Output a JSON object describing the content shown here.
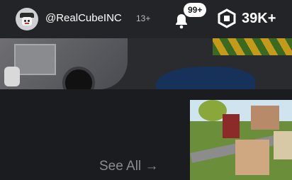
{
  "header": {
    "username": "@RealCubeINC",
    "age_badge": "13+",
    "notifications_count": "99+",
    "robux_amount": "39K+"
  },
  "content": {
    "see_all_label": "See All",
    "see_all_arrow": "→"
  },
  "icons": {
    "avatar": "avatar-image",
    "bell": "bell-icon",
    "robux": "robux-icon"
  },
  "colors": {
    "topbar_bg": "#232428",
    "page_bg": "#1b1c1f",
    "text_primary": "#ffffff",
    "text_muted": "#8a8b8e",
    "badge_bg": "#ffffff"
  }
}
